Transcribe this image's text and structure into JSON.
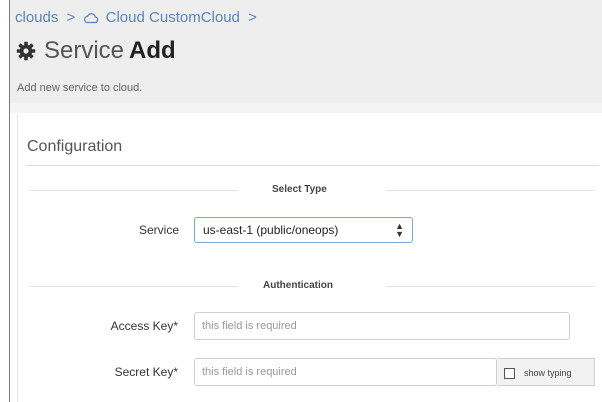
{
  "breadcrumb": {
    "root": "clouds",
    "separator": ">",
    "cloud_prefix": "Cloud",
    "cloud_name": "CustomCloud",
    "trailing_separator": ">"
  },
  "page": {
    "title_light": "Service",
    "title_bold": "Add",
    "subtitle": "Add new service to cloud."
  },
  "panel": {
    "title": "Configuration"
  },
  "select_type_section": {
    "heading": "Select Type",
    "service_label": "Service",
    "service_value": "us-east-1 (public/oneops)"
  },
  "auth_section": {
    "heading": "Authentication",
    "access_key_label": "Access Key*",
    "access_key_placeholder": "this field is required",
    "secret_key_label": "Secret Key*",
    "secret_key_placeholder": "this field is required",
    "show_typing_label": "show typing",
    "show_typing_checked": false
  },
  "colors": {
    "link": "#5b86b8",
    "header_bg": "#eeeeee",
    "select_border": "#7ea6d8"
  }
}
